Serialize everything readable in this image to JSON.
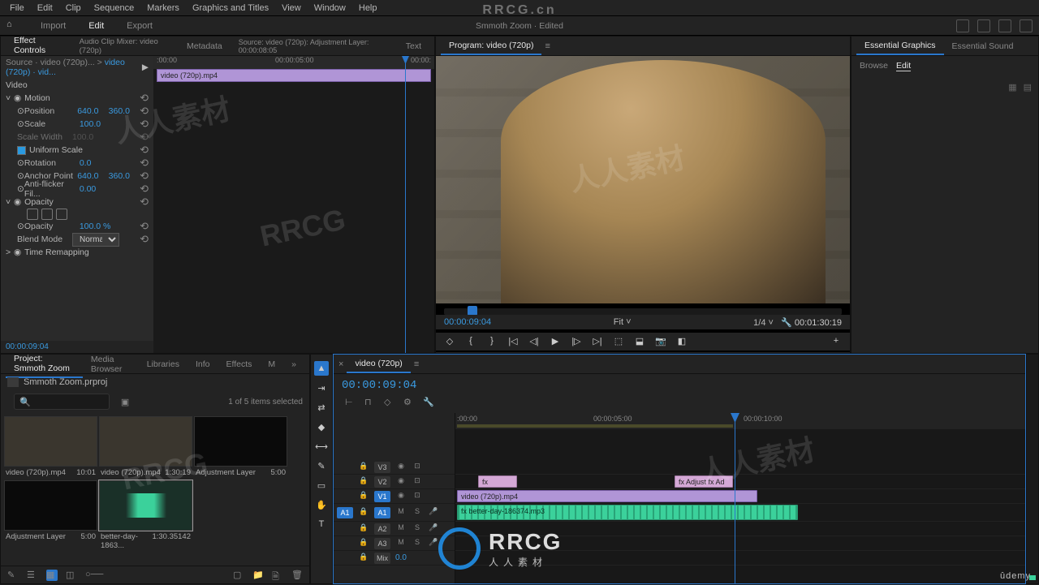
{
  "menubar": [
    "File",
    "Edit",
    "Clip",
    "Sequence",
    "Markers",
    "Graphics and Titles",
    "View",
    "Window",
    "Help"
  ],
  "workspace": {
    "tabs": [
      "Import",
      "Edit",
      "Export"
    ],
    "active": "Edit",
    "center": "Smmoth Zoom · Edited"
  },
  "sourcePanel": {
    "tabs": [
      "Effect Controls",
      "Audio Clip Mixer: video (720p)",
      "Metadata",
      "Source: video (720p): Adjustment Layer: 00:00:08:05",
      "Text"
    ],
    "breadcrumb": {
      "source": "Source · video (720p)...",
      "seq": "video (720p) · vid..."
    },
    "videoLabel": "Video",
    "motion": {
      "label": "Motion",
      "position": {
        "label": "Position",
        "x": "640.0",
        "y": "360.0"
      },
      "scale": {
        "label": "Scale",
        "val": "100.0"
      },
      "scaleWidth": {
        "label": "Scale Width",
        "val": "100.0"
      },
      "uniform": {
        "label": "Uniform Scale"
      },
      "rotation": {
        "label": "Rotation",
        "val": "0.0"
      },
      "anchor": {
        "label": "Anchor Point",
        "x": "640.0",
        "y": "360.0"
      },
      "antiflicker": {
        "label": "Anti-flicker Fil...",
        "val": "0.00"
      }
    },
    "opacity": {
      "label": "Opacity",
      "opacityVal": {
        "label": "Opacity",
        "val": "100.0 %"
      },
      "blend": {
        "label": "Blend Mode",
        "val": "Normal"
      }
    },
    "timeRemap": {
      "label": "Time Remapping"
    },
    "tlClip": "video (720p).mp4",
    "ruler": {
      "a": ":00:00",
      "b": "00:00:05:00",
      "c": "00:00:"
    },
    "bottomTc": "00:00:09:04"
  },
  "program": {
    "title": "Program: video (720p)",
    "leftTc": "00:00:09:04",
    "fit": "Fit",
    "zoom": "1/4",
    "rightTc": "00:01:30:19"
  },
  "essentials": {
    "tabs": [
      "Essential Graphics",
      "Essential Sound"
    ],
    "sub": [
      "Browse",
      "Edit"
    ]
  },
  "project": {
    "tabs": [
      "Project: Smmoth Zoom",
      "Media Browser",
      "Libraries",
      "Info",
      "Effects",
      "M",
      "»"
    ],
    "binName": "Smmoth Zoom.prproj",
    "status": "1 of 5 items selected",
    "items": [
      {
        "name": "video (720p).mp4",
        "dur": "10:01"
      },
      {
        "name": "video (720p).mp4",
        "dur": "1:30:19"
      },
      {
        "name": "Adjustment Layer",
        "dur": "5:00"
      },
      {
        "name": "Adjustment Layer",
        "dur": "5:00"
      },
      {
        "name": "better-day-1863...",
        "dur": "1:30.35142"
      }
    ]
  },
  "timeline": {
    "seqName": "video (720p)",
    "tc": "00:00:09:04",
    "ruler": {
      "a": ":00:00",
      "b": "00:00:05:00",
      "c": "00:00:10:00"
    },
    "tracks": {
      "v3": "V3",
      "v2": "V2",
      "v1": "V1",
      "a1": "A1",
      "a2": "A2",
      "a3": "A3",
      "mix": "Mix",
      "mixVal": "0.0"
    },
    "trackBtns": {
      "lock": "🔒",
      "fx": "fx",
      "m": "M",
      "s": "S",
      "eye": "◉",
      "mute": "M",
      "solo": "S",
      "rec": "●"
    },
    "clips": {
      "v1": "video (720p).mp4",
      "adj1": "fx",
      "adj2": "fx  Adjust   fx  Ad",
      "a1": "fx  better-day-186374.mp3"
    }
  },
  "watermarks": {
    "site": "RRCG.cn",
    "brand": "RRCG",
    "sub": "人人素材",
    "udemy": "ûdemy",
    "corner": "人人素材"
  }
}
